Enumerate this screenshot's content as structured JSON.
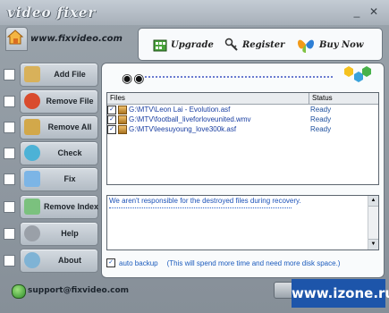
{
  "app": {
    "title": "video fixer",
    "url": "www.fixvideo.com"
  },
  "window_controls": {
    "minimize": "_",
    "close": "✕"
  },
  "toolbar": {
    "upgrade": "Upgrade",
    "register": "Register",
    "buy": "Buy Now"
  },
  "sidebar": {
    "items": [
      {
        "label": "Add File",
        "icon": "folder-open-icon",
        "color": "#d8b15a"
      },
      {
        "label": "Remove File",
        "icon": "remove-file-icon",
        "color": "#d94b2d"
      },
      {
        "label": "Remove All",
        "icon": "recycle-bin-icon",
        "color": "#d2a84a"
      },
      {
        "label": "Check",
        "icon": "magnifier-check-icon",
        "color": "#4cb2d6"
      },
      {
        "label": "Fix",
        "icon": "fix-tool-icon",
        "color": "#7cb5e6"
      },
      {
        "label": "Remove Index",
        "icon": "remove-index-icon",
        "color": "#7bc17e"
      },
      {
        "label": "Help",
        "icon": "help-icon",
        "color": "#9aa0a8"
      },
      {
        "label": "About",
        "icon": "info-icon",
        "color": "#7fb3d5"
      }
    ]
  },
  "files": {
    "headers": {
      "files": "Files",
      "status": "Status"
    },
    "rows": [
      {
        "path": "G:\\MTV\\Leon Lai - Evolution.asf",
        "status": "Ready"
      },
      {
        "path": "G:\\MTV\\football_liveforloveunited.wmv",
        "status": "Ready"
      },
      {
        "path": "G:\\MTV\\leesuyoung_love300k.asf",
        "status": "Ready"
      }
    ]
  },
  "message": "We aren't responsible for the destroyed files during recovery.",
  "auto_backup": {
    "label": "auto backup",
    "note": "(This will spend more time and need more disk space.)"
  },
  "footer": {
    "email": "support@fixvideo.com",
    "watermark": "www.izone.ru"
  },
  "colors": {
    "accent_blue": "#1c52b8",
    "watermark_bg": "#1d55aa"
  }
}
